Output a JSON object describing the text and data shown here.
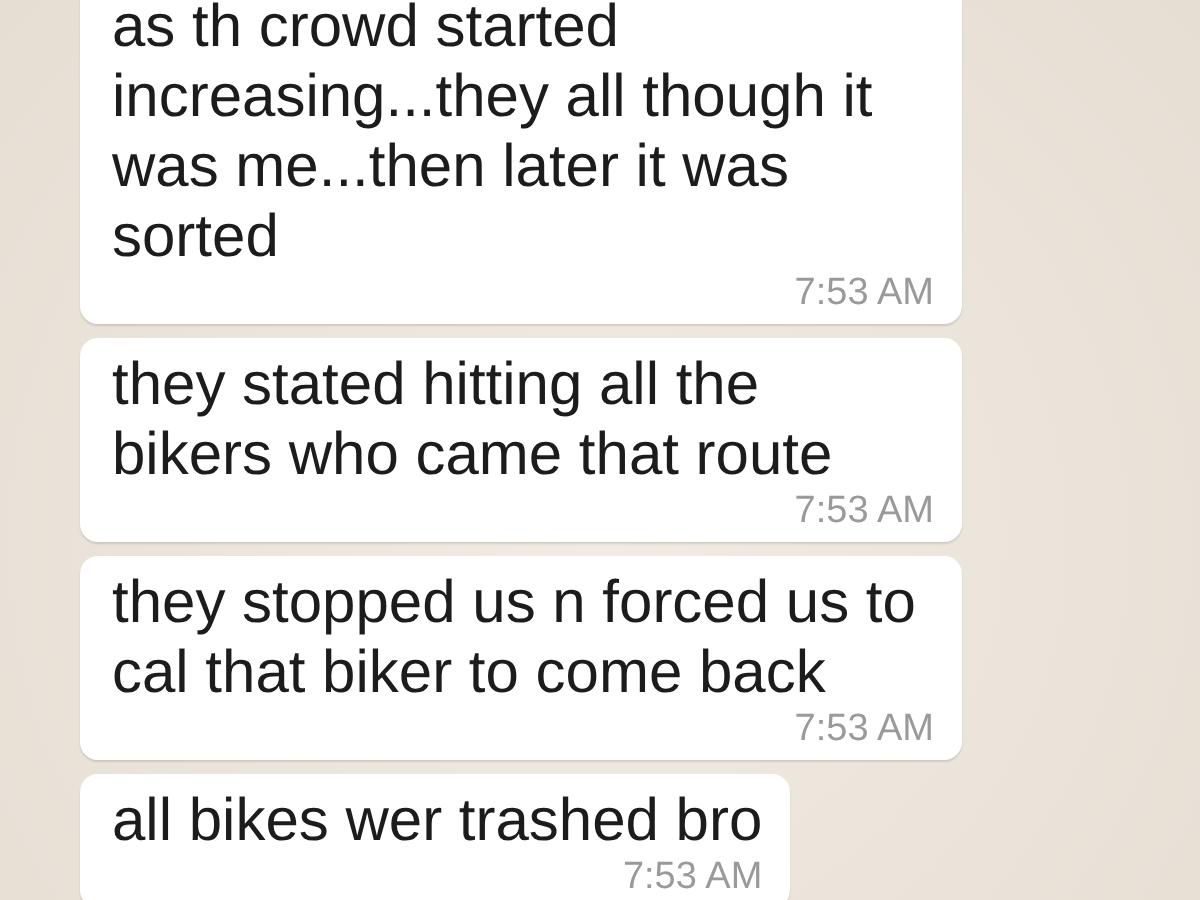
{
  "messages": [
    {
      "text": "as th crowd started increasing...they all though it was me...then later it was sorted",
      "time": "7:53 AM"
    },
    {
      "text": "they stated hitting all the bikers who came that route",
      "time": "7:53 AM"
    },
    {
      "text": "they stopped us n forced us to cal that biker to come back",
      "time": "7:53 AM"
    },
    {
      "text": "all bikes wer trashed bro",
      "time": "7:53 AM"
    }
  ]
}
